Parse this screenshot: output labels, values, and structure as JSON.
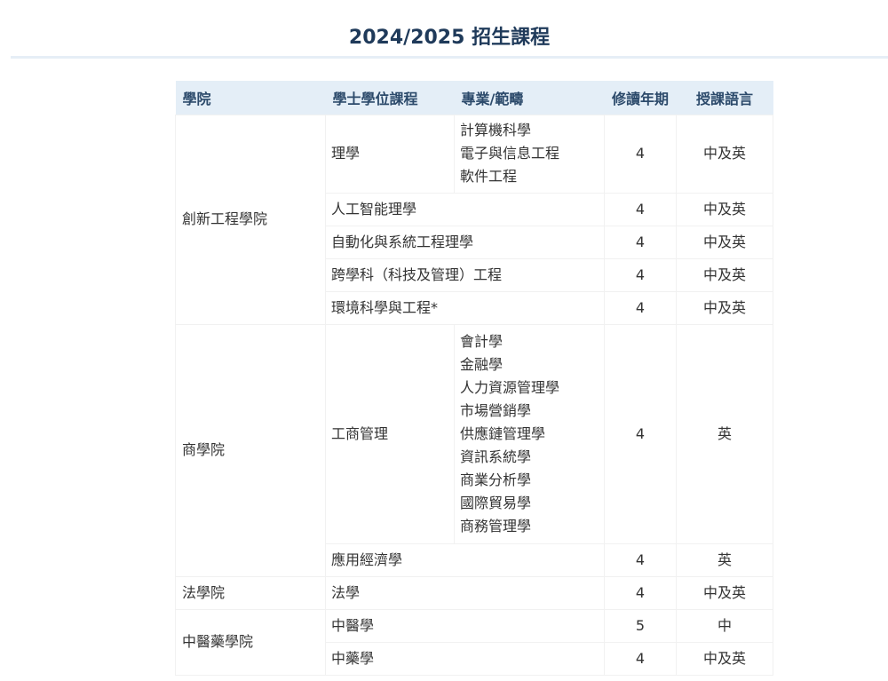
{
  "page": {
    "title": "2024/2025 招生課程"
  },
  "table": {
    "headers": [
      "學院",
      "學士學位課程",
      "專業/範疇",
      "修讀年期",
      "授課語言"
    ],
    "rows": [
      {
        "faculty": "創新工程學院",
        "programme": "理學",
        "specializations": [
          "計算機科學",
          "電子與信息工程",
          "軟件工程"
        ],
        "years": "4",
        "language": "中及英"
      },
      {
        "programme": "人工智能理學",
        "years": "4",
        "language": "中及英"
      },
      {
        "programme": "自動化與系統工程理學",
        "years": "4",
        "language": "中及英"
      },
      {
        "programme": "跨學科（科技及管理）工程",
        "years": "4",
        "language": "中及英"
      },
      {
        "programme": "環境科學與工程*",
        "years": "4",
        "language": "中及英"
      },
      {
        "faculty": "商學院",
        "programme": "工商管理",
        "specializations": [
          "會計學",
          "金融學",
          "人力資源管理學",
          "市場營銷學",
          "供應鏈管理學",
          "資訊系統學",
          "商業分析學",
          "國際貿易學",
          "商務管理學"
        ],
        "years": "4",
        "language": "英"
      },
      {
        "programme": "應用經濟學",
        "years": "4",
        "language": "英"
      },
      {
        "faculty": "法學院",
        "programme": "法學",
        "years": "4",
        "language": "中及英"
      },
      {
        "faculty": "中醫藥學院",
        "programme": "中醫學",
        "years": "5",
        "language": "中"
      },
      {
        "programme": "中藥學",
        "years": "4",
        "language": "中及英"
      }
    ]
  }
}
